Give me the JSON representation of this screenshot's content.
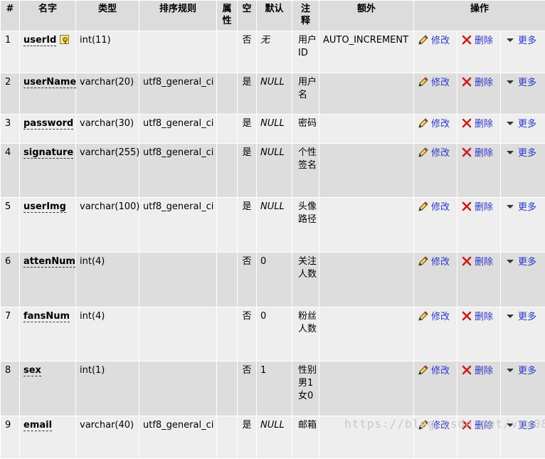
{
  "headers": {
    "num": "#",
    "name": "名字",
    "type": "类型",
    "collation": "排序规则",
    "attributes": "属性",
    "null": "空",
    "default": "默认",
    "comment": "注释",
    "extra": "额外",
    "action": "操作"
  },
  "actions": {
    "edit": "修改",
    "delete": "删除",
    "more": "更多"
  },
  "rows": [
    {
      "num": "1",
      "name": "userId",
      "type": "int(11)",
      "collation": "",
      "attributes": "",
      "null": "否",
      "default": "无",
      "comment": "用户ID",
      "extra": "AUTO_INCREMENT"
    },
    {
      "num": "2",
      "name": "userName",
      "type": "varchar(20)",
      "collation": "utf8_general_ci",
      "attributes": "",
      "null": "是",
      "default": "NULL",
      "comment": "用户名",
      "extra": ""
    },
    {
      "num": "3",
      "name": "password",
      "type": "varchar(30)",
      "collation": "utf8_general_ci",
      "attributes": "",
      "null": "是",
      "default": "NULL",
      "comment": "密码",
      "extra": ""
    },
    {
      "num": "4",
      "name": "signature",
      "type": "varchar(255)",
      "collation": "utf8_general_ci",
      "attributes": "",
      "null": "是",
      "default": "NULL",
      "comment": "个性签名",
      "extra": ""
    },
    {
      "num": "5",
      "name": "userImg",
      "type": "varchar(100)",
      "collation": "utf8_general_ci",
      "attributes": "",
      "null": "是",
      "default": "NULL",
      "comment": "头像路径",
      "extra": ""
    },
    {
      "num": "6",
      "name": "attenNum",
      "type": "int(4)",
      "collation": "",
      "attributes": "",
      "null": "否",
      "default": "0",
      "comment": "关注人数",
      "extra": ""
    },
    {
      "num": "7",
      "name": "fansNum",
      "type": "int(4)",
      "collation": "",
      "attributes": "",
      "null": "否",
      "default": "0",
      "comment": "粉丝人数",
      "extra": ""
    },
    {
      "num": "8",
      "name": "sex",
      "type": "int(1)",
      "collation": "",
      "attributes": "",
      "null": "否",
      "default": "1",
      "comment": "性别男1女0",
      "extra": ""
    },
    {
      "num": "9",
      "name": "email",
      "type": "varchar(40)",
      "collation": "utf8_general_ci",
      "attributes": "",
      "null": "是",
      "default": "NULL",
      "comment": "邮箱",
      "extra": ""
    }
  ],
  "watermark": "https://blog.csdn.net/vcx08",
  "colors": {
    "link": "#2a38c6",
    "header_bg": "#dcdcdc",
    "row_light": "#eeeeee",
    "row_dark": "#dddddd"
  }
}
